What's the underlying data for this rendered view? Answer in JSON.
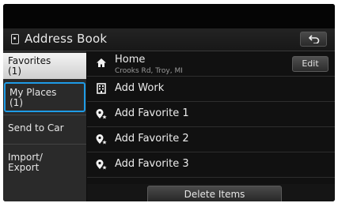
{
  "header": {
    "title": "Address Book"
  },
  "sidebar": {
    "items": [
      {
        "label": "Favorites",
        "count": "(1)"
      },
      {
        "label": "My Places",
        "count": "(1)"
      },
      {
        "label": "Send to Car"
      },
      {
        "label": "Import/",
        "label2": "Export"
      }
    ]
  },
  "list": {
    "home": {
      "label": "Home",
      "address": "Crooks Rd, Troy, MI",
      "edit_label": "Edit"
    },
    "rows": [
      {
        "label": "Add Work",
        "icon": "building-icon"
      },
      {
        "label": "Add Favorite 1",
        "icon": "favorite-pin-icon"
      },
      {
        "label": "Add Favorite 2",
        "icon": "favorite-pin-icon"
      },
      {
        "label": "Add Favorite 3",
        "icon": "favorite-pin-icon"
      }
    ]
  },
  "actions": {
    "delete_label": "Delete Items"
  },
  "colors": {
    "focus": "#1e9be6",
    "selected_bg": "#e6e6e6",
    "background": "#111111"
  }
}
